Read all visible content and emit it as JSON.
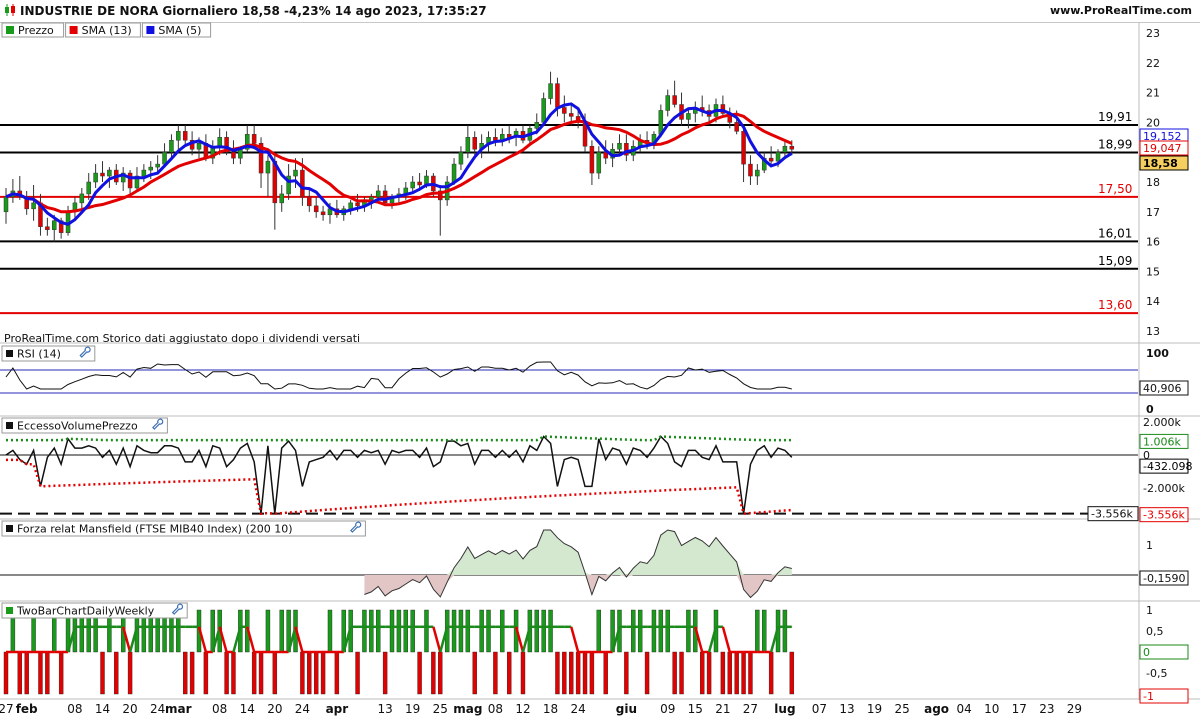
{
  "header": {
    "title": "INDUSTRIE DE NORA Giornaliero 18,58 -4,23% 14 ago 2023, 17:35:27",
    "site": "www.ProRealTime.com"
  },
  "panels": {
    "price": {
      "legend": [
        {
          "label": "Prezzo",
          "color": "#1a9a1a"
        },
        {
          "label": "SMA (13)",
          "color": "#e30000"
        },
        {
          "label": "SMA (5)",
          "color": "#1010e0"
        }
      ],
      "note": "ProRealTime.com Storico dati aggiustato dopo i dividendi versati",
      "y_ticks": [
        "23",
        "22",
        "21",
        "20",
        "19",
        "18",
        "17",
        "16",
        "15",
        "14",
        "13"
      ],
      "levels": [
        {
          "label": "19,91",
          "color": "#000000",
          "value": 19.91
        },
        {
          "label": "18,99",
          "color": "#000000",
          "value": 18.99
        },
        {
          "label": "17,50",
          "color": "#e30000",
          "value": 17.5
        },
        {
          "label": "16,01",
          "color": "#000000",
          "value": 16.01
        },
        {
          "label": "15,09",
          "color": "#000000",
          "value": 15.09
        },
        {
          "label": "13,60",
          "color": "#e30000",
          "value": 13.6
        }
      ],
      "tags": [
        {
          "label": "19,152",
          "color": "#1010e0",
          "value": 19.152,
          "bold": false
        },
        {
          "label": "19,047",
          "color": "#e30000",
          "value": 19.047,
          "bold": false
        },
        {
          "label": "18,58",
          "color": "#000000",
          "value": 18.58,
          "bold": true,
          "bg": "#f5d060"
        }
      ]
    },
    "rsi": {
      "legend": "RSI (14)",
      "y_ticks": [
        "100",
        "0"
      ],
      "tag": "40,906"
    },
    "evp": {
      "legend": "EccessoVolumePrezzo",
      "y_ticks": [
        "2.000k",
        "0",
        "-2.000k"
      ],
      "tags": [
        {
          "label": "1.006k",
          "color": "#1a8a1a",
          "value": 1006
        },
        {
          "label": "-432.098",
          "color": "#000000",
          "value": -432
        },
        {
          "label": "-3.556k",
          "color": "#e30000",
          "value": -3556
        }
      ],
      "dash_label": "-3.556k"
    },
    "mansfield": {
      "legend": "Forza relat Mansfield (FTSE MIB40 Index) (200 10)",
      "y_ticks": [
        "1",
        "0"
      ],
      "tag": "-0,1590"
    },
    "twobar": {
      "legend": "TwoBarChartDailyWeekly",
      "y_ticks": [
        "1",
        "0,5",
        "0",
        "-0,5",
        "-1"
      ],
      "tags": [
        "0",
        "-1"
      ]
    }
  },
  "x_axis": {
    "labels": [
      {
        "t": "27",
        "i": 0,
        "bold": false
      },
      {
        "t": "feb",
        "i": 3,
        "bold": true
      },
      {
        "t": "08",
        "i": 10,
        "bold": false
      },
      {
        "t": "14",
        "i": 14,
        "bold": false
      },
      {
        "t": "20",
        "i": 18,
        "bold": false
      },
      {
        "t": "24",
        "i": 22,
        "bold": false
      },
      {
        "t": "mar",
        "i": 25,
        "bold": true
      },
      {
        "t": "08",
        "i": 31,
        "bold": false
      },
      {
        "t": "14",
        "i": 35,
        "bold": false
      },
      {
        "t": "20",
        "i": 39,
        "bold": false
      },
      {
        "t": "24",
        "i": 43,
        "bold": false
      },
      {
        "t": "apr",
        "i": 48,
        "bold": true
      },
      {
        "t": "13",
        "i": 55,
        "bold": false
      },
      {
        "t": "19",
        "i": 59,
        "bold": false
      },
      {
        "t": "25",
        "i": 63,
        "bold": false
      },
      {
        "t": "mag",
        "i": 67,
        "bold": true
      },
      {
        "t": "08",
        "i": 71,
        "bold": false
      },
      {
        "t": "12",
        "i": 75,
        "bold": false
      },
      {
        "t": "18",
        "i": 79,
        "bold": false
      },
      {
        "t": "24",
        "i": 83,
        "bold": false
      },
      {
        "t": "giu",
        "i": 90,
        "bold": true
      },
      {
        "t": "09",
        "i": 96,
        "bold": false
      },
      {
        "t": "15",
        "i": 100,
        "bold": false
      },
      {
        "t": "21",
        "i": 104,
        "bold": false
      },
      {
        "t": "27",
        "i": 108,
        "bold": false
      },
      {
        "t": "lug",
        "i": 113,
        "bold": true
      },
      {
        "t": "07",
        "i": 118,
        "bold": false
      },
      {
        "t": "13",
        "i": 122,
        "bold": false
      },
      {
        "t": "19",
        "i": 126,
        "bold": false
      },
      {
        "t": "25",
        "i": 130,
        "bold": false
      },
      {
        "t": "ago",
        "i": 135,
        "bold": true
      },
      {
        "t": "04",
        "i": 139,
        "bold": false
      },
      {
        "t": "10",
        "i": 143,
        "bold": false
      },
      {
        "t": "17",
        "i": 147,
        "bold": false
      },
      {
        "t": "23",
        "i": 151,
        "bold": false
      },
      {
        "t": "29",
        "i": 155,
        "bold": false
      }
    ]
  },
  "chart_data": {
    "type": "candlestick",
    "ylim": [
      12.7,
      23.3
    ],
    "ohlc": [
      [
        17.0,
        17.8,
        16.6,
        17.5
      ],
      [
        17.5,
        18.1,
        17.3,
        17.7
      ],
      [
        17.7,
        18.2,
        17.4,
        17.5
      ],
      [
        17.5,
        17.7,
        16.9,
        17.1
      ],
      [
        17.1,
        17.9,
        16.7,
        17.3
      ],
      [
        17.3,
        17.6,
        16.2,
        16.5
      ],
      [
        16.5,
        16.8,
        16.2,
        16.4
      ],
      [
        16.4,
        16.9,
        16.0,
        16.7
      ],
      [
        16.7,
        16.8,
        16.1,
        16.3
      ],
      [
        16.3,
        17.2,
        16.2,
        17.0
      ],
      [
        17.0,
        17.5,
        16.8,
        17.3
      ],
      [
        17.3,
        17.8,
        17.1,
        17.6
      ],
      [
        17.6,
        18.3,
        17.4,
        18.0
      ],
      [
        18.0,
        18.6,
        17.8,
        18.3
      ],
      [
        18.3,
        18.7,
        18.0,
        18.2
      ],
      [
        18.2,
        18.5,
        17.8,
        18.4
      ],
      [
        18.4,
        18.6,
        17.9,
        18.0
      ],
      [
        18.0,
        18.5,
        17.7,
        18.3
      ],
      [
        18.3,
        18.4,
        17.6,
        17.8
      ],
      [
        17.8,
        18.5,
        17.7,
        18.2
      ],
      [
        18.2,
        18.6,
        18.0,
        18.4
      ],
      [
        18.4,
        18.7,
        18.1,
        18.5
      ],
      [
        18.5,
        18.9,
        18.3,
        18.6
      ],
      [
        18.6,
        19.3,
        18.5,
        19.0
      ],
      [
        19.0,
        19.6,
        18.8,
        19.4
      ],
      [
        19.4,
        19.9,
        19.1,
        19.7
      ],
      [
        19.7,
        19.9,
        19.2,
        19.4
      ],
      [
        19.4,
        19.7,
        18.9,
        19.1
      ],
      [
        19.1,
        19.5,
        18.8,
        19.3
      ],
      [
        19.3,
        19.6,
        18.7,
        18.8
      ],
      [
        18.8,
        19.4,
        18.6,
        19.2
      ],
      [
        19.2,
        19.8,
        18.9,
        19.5
      ],
      [
        19.5,
        19.7,
        18.9,
        19.0
      ],
      [
        19.0,
        19.4,
        18.6,
        18.8
      ],
      [
        18.8,
        19.2,
        18.6,
        19.1
      ],
      [
        19.1,
        19.9,
        19.0,
        19.6
      ],
      [
        19.6,
        19.9,
        19.1,
        19.3
      ],
      [
        19.3,
        19.5,
        17.8,
        18.3
      ],
      [
        18.3,
        18.9,
        17.5,
        18.7
      ],
      [
        18.7,
        18.9,
        16.4,
        17.3
      ],
      [
        17.3,
        17.9,
        17.0,
        17.6
      ],
      [
        17.6,
        18.6,
        17.4,
        18.2
      ],
      [
        18.2,
        18.8,
        17.8,
        18.4
      ],
      [
        18.4,
        18.8,
        17.2,
        17.5
      ],
      [
        17.5,
        17.8,
        17.0,
        17.2
      ],
      [
        17.2,
        17.5,
        16.8,
        17.0
      ],
      [
        17.0,
        17.2,
        16.7,
        16.9
      ],
      [
        16.9,
        17.3,
        16.6,
        17.1
      ],
      [
        17.1,
        17.4,
        16.8,
        16.9
      ],
      [
        16.9,
        17.2,
        16.7,
        17.1
      ],
      [
        17.1,
        17.4,
        16.9,
        17.3
      ],
      [
        17.3,
        17.6,
        17.0,
        17.2
      ],
      [
        17.2,
        17.5,
        17.0,
        17.4
      ],
      [
        17.4,
        17.6,
        17.1,
        17.5
      ],
      [
        17.5,
        17.9,
        17.3,
        17.7
      ],
      [
        17.7,
        17.9,
        17.2,
        17.3
      ],
      [
        17.3,
        17.6,
        17.1,
        17.5
      ],
      [
        17.5,
        17.8,
        17.3,
        17.6
      ],
      [
        17.6,
        18.0,
        17.4,
        17.8
      ],
      [
        17.8,
        18.2,
        17.6,
        18.0
      ],
      [
        18.0,
        18.3,
        17.7,
        17.9
      ],
      [
        17.9,
        18.4,
        17.8,
        18.2
      ],
      [
        18.2,
        18.3,
        17.5,
        17.7
      ],
      [
        17.7,
        17.9,
        16.2,
        17.4
      ],
      [
        17.4,
        18.2,
        17.2,
        18.0
      ],
      [
        18.0,
        18.8,
        17.9,
        18.6
      ],
      [
        18.6,
        19.2,
        18.4,
        19.0
      ],
      [
        19.0,
        19.9,
        18.8,
        19.5
      ],
      [
        19.5,
        19.7,
        18.9,
        19.1
      ],
      [
        19.1,
        19.6,
        18.8,
        19.3
      ],
      [
        19.3,
        19.7,
        19.0,
        19.5
      ],
      [
        19.5,
        19.8,
        19.2,
        19.4
      ],
      [
        19.4,
        19.8,
        19.2,
        19.6
      ],
      [
        19.6,
        19.9,
        19.3,
        19.5
      ],
      [
        19.5,
        19.8,
        19.2,
        19.7
      ],
      [
        19.7,
        19.9,
        19.3,
        19.4
      ],
      [
        19.4,
        19.9,
        19.3,
        19.8
      ],
      [
        19.8,
        20.3,
        19.6,
        20.0
      ],
      [
        20.0,
        21.0,
        19.9,
        20.8
      ],
      [
        20.8,
        21.7,
        20.6,
        21.3
      ],
      [
        21.3,
        21.5,
        20.2,
        20.5
      ],
      [
        20.5,
        20.9,
        20.0,
        20.3
      ],
      [
        20.3,
        20.6,
        19.9,
        20.2
      ],
      [
        20.2,
        20.5,
        19.8,
        20.0
      ],
      [
        20.0,
        20.3,
        19.0,
        19.2
      ],
      [
        19.2,
        19.4,
        17.9,
        18.3
      ],
      [
        18.3,
        19.2,
        18.1,
        19.0
      ],
      [
        19.0,
        19.4,
        18.6,
        18.8
      ],
      [
        18.8,
        19.3,
        18.5,
        19.1
      ],
      [
        19.1,
        19.6,
        18.9,
        19.3
      ],
      [
        19.3,
        19.6,
        18.7,
        18.9
      ],
      [
        18.9,
        19.4,
        18.7,
        19.2
      ],
      [
        19.2,
        19.6,
        19.0,
        19.4
      ],
      [
        19.4,
        19.7,
        19.1,
        19.3
      ],
      [
        19.3,
        19.7,
        19.1,
        19.6
      ],
      [
        19.6,
        20.6,
        19.5,
        20.4
      ],
      [
        20.4,
        21.1,
        20.2,
        20.9
      ],
      [
        20.9,
        21.4,
        20.5,
        20.6
      ],
      [
        20.6,
        21.0,
        19.9,
        20.1
      ],
      [
        20.1,
        20.5,
        19.8,
        20.3
      ],
      [
        20.3,
        20.7,
        20.0,
        20.5
      ],
      [
        20.5,
        20.9,
        20.2,
        20.4
      ],
      [
        20.4,
        20.6,
        19.9,
        20.2
      ],
      [
        20.2,
        20.8,
        20.0,
        20.6
      ],
      [
        20.6,
        20.9,
        20.2,
        20.3
      ],
      [
        20.3,
        20.5,
        19.8,
        20.0
      ],
      [
        20.0,
        20.4,
        19.6,
        19.7
      ],
      [
        19.7,
        19.9,
        18.0,
        18.6
      ],
      [
        18.6,
        18.9,
        17.9,
        18.2
      ],
      [
        18.2,
        18.6,
        17.9,
        18.4
      ],
      [
        18.4,
        19.0,
        18.3,
        18.8
      ],
      [
        18.8,
        19.2,
        18.5,
        18.7
      ],
      [
        18.7,
        19.1,
        18.5,
        19.0
      ],
      [
        19.0,
        19.4,
        18.8,
        19.2
      ],
      [
        19.2,
        19.4,
        18.9,
        19.1
      ]
    ]
  }
}
